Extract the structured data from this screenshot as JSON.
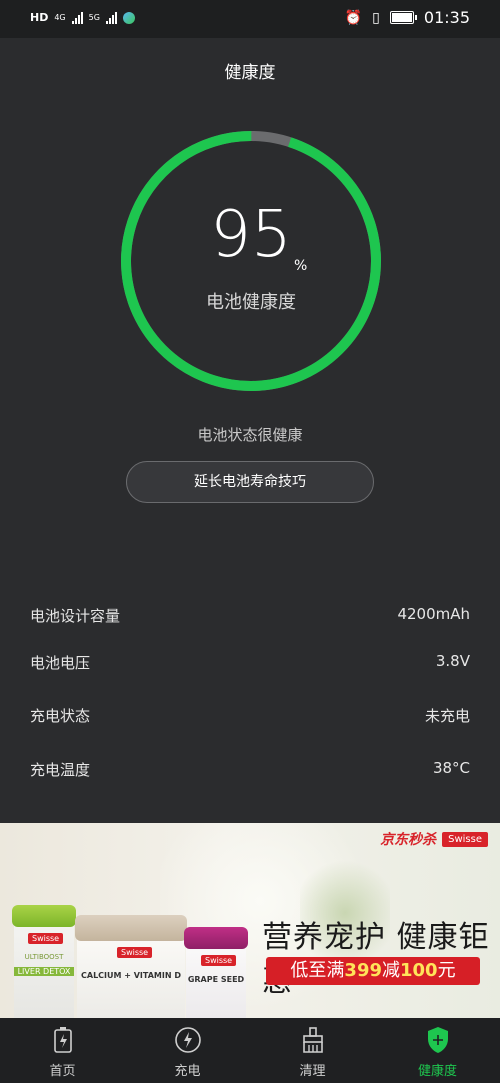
{
  "status_bar": {
    "network": [
      "HD",
      "4G",
      "5G"
    ],
    "time": "01:35"
  },
  "header": {
    "title": "健康度"
  },
  "battery_health": {
    "percent": "95",
    "percent_sign": "%",
    "label": "电池健康度",
    "ring_fraction": 0.95,
    "ring_color": "#1ec64f"
  },
  "status_message": "电池状态很健康",
  "tips_button": "延长电池寿命技巧",
  "info": [
    {
      "label": "电池设计容量",
      "value": "4200mAh"
    },
    {
      "label": "电池电压",
      "value": "3.8V"
    },
    {
      "label": "充电状态",
      "value": "未充电"
    },
    {
      "label": "充电温度",
      "value": "38°C"
    }
  ],
  "ad": {
    "brand_left": "京东秒杀",
    "brand_right": "Swisse",
    "slogan": "营养宠护 健康钜惠",
    "promo_prefix": "低至满",
    "promo_amount1": "399",
    "promo_mid": "减",
    "promo_amount2": "100",
    "promo_suffix": "元",
    "products": [
      {
        "badge": "Swisse",
        "line1": "ULTIBOOST",
        "line2": "LIVER DETOX"
      },
      {
        "badge": "Swisse",
        "line1": "CALCIUM + VITAMIN D",
        "line2": ""
      },
      {
        "badge": "Swisse",
        "line1": "GRAPE SEED",
        "line2": ""
      }
    ]
  },
  "nav": [
    {
      "label": "首页",
      "icon": "battery-icon"
    },
    {
      "label": "充电",
      "icon": "charge-icon"
    },
    {
      "label": "清理",
      "icon": "broom-icon"
    },
    {
      "label": "健康度",
      "icon": "shield-icon",
      "active": true
    }
  ]
}
